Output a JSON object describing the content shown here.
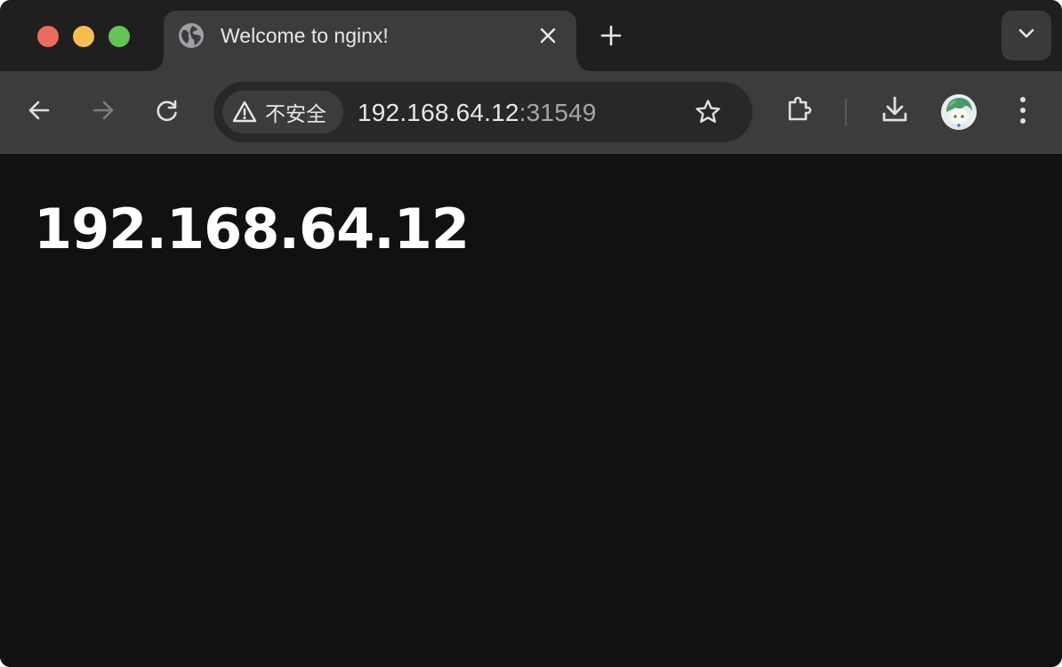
{
  "colors": {
    "traffic_close": "#ed6a5e",
    "traffic_minimize": "#f5bf4f",
    "traffic_zoom": "#61c554",
    "tab_active": "#3c3c3c",
    "tabstrip": "#1f1f1f",
    "page_background": "#111111"
  },
  "tab": {
    "title": "Welcome to nginx!",
    "favicon": "globe-icon"
  },
  "toolbar": {
    "security_label": "不安全",
    "url_host": "192.168.64.12",
    "url_port": ":31549"
  },
  "page": {
    "heading": "192.168.64.12"
  }
}
